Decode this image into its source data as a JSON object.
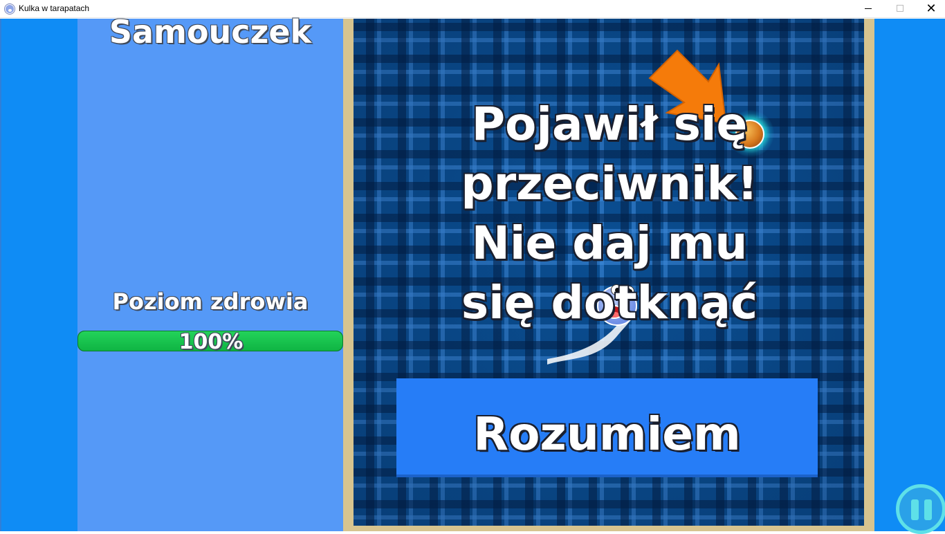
{
  "window": {
    "title": "Kulka w tarapatach",
    "controls": {
      "minimize": "minimize-icon",
      "maximize": "maximize-icon",
      "close": "✕"
    }
  },
  "sidebar": {
    "title": "Samouczek",
    "health_label": "Poziom zdrowia",
    "health_value": "100%",
    "health_fraction": 1.0
  },
  "tutorial": {
    "message_lines": [
      "Pojawił się",
      "przeciwnik!",
      "Nie daj mu",
      "się dotknąć"
    ],
    "confirm_label": "Rozumiem"
  },
  "icons": {
    "pause": "pause-icon",
    "arrow": "arrow-pointer-icon",
    "enemy": "enemy-ball-icon",
    "player": "player-ball-icon"
  },
  "colors": {
    "background": "#0f8cf5",
    "panel": "#5599f7",
    "health_bar": "#13a33c",
    "button": "#267df7",
    "arrow": "#f57b0a",
    "board": "#0a4f92",
    "frame": "#d7c48f"
  }
}
